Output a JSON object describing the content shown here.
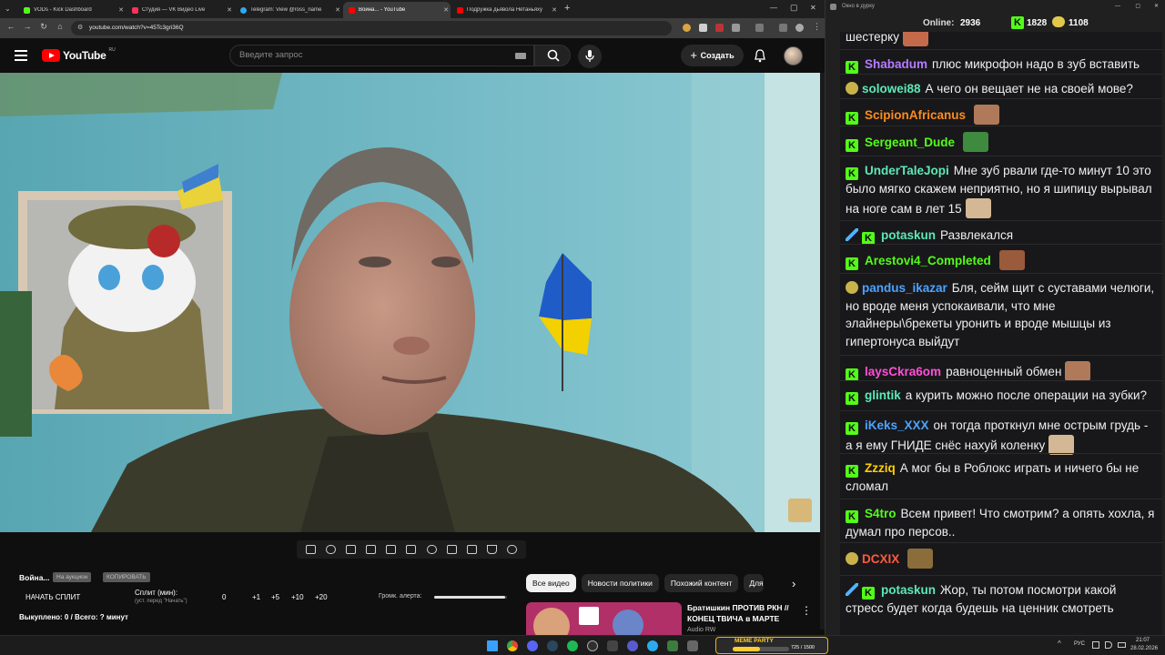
{
  "browser": {
    "tabs": [
      {
        "label": "VODs - Kick Dashboard",
        "color": "#53fc18"
      },
      {
        "label": "Студия — VK Видео Live",
        "color": "#ff3355"
      },
      {
        "label": "Telegram: View @ross_name",
        "color": "#2aabee"
      },
      {
        "label": "Война... - YouTube",
        "color": "#ff0000"
      },
      {
        "label": "Подружка дьявола Нетаньяху",
        "color": "#ff0000"
      }
    ],
    "new_tab": "+",
    "url": "youtube.com/watch?v=45Tc3gri36Q",
    "window_controls": [
      "—",
      "▢",
      "✕"
    ]
  },
  "youtube": {
    "logo_text": "YouTube",
    "logo_cc": "RU",
    "search_placeholder": "Введите запрос",
    "create_label": "Создать",
    "icons": [
      "menu-icon",
      "search-icon",
      "mic-icon",
      "bell-icon",
      "avatar"
    ]
  },
  "video_controls": {
    "icons": [
      "repeat-icon",
      "broadcast-icon",
      "camera-settings-icon",
      "clip-icon",
      "screen-icon",
      "subtitles-icon",
      "speed-icon",
      "add-icon",
      "screenshot-icon",
      "flask-icon",
      "gear-icon"
    ]
  },
  "tool": {
    "title": "Война...",
    "btn_auction": "На аукцион",
    "btn_copy": "КОПИРОВАТЬ",
    "start_split": "НАЧАТЬ СПЛИТ",
    "split_label": "Сплит (мин):",
    "split_hint": "(уст. перед \"Начать\")",
    "split_value": "0",
    "increments": [
      "+1",
      "+5",
      "+10",
      "+20"
    ],
    "alert_label": "Громк. алерта:",
    "bought": "Выкуплено: 0 / Всего: ? минут",
    "alert_volume": 0.98
  },
  "chips": [
    "Все видео",
    "Новости политики",
    "Похожий контент",
    "Для вас"
  ],
  "recommendation": {
    "title_line1": "Братишкин ПРОТИВ РКН //",
    "title_line2": "КОНЕЦ ТВИЧА в МАРТЕ",
    "channel": "Audio RW"
  },
  "chat": {
    "window_title": "Окно в дурку",
    "online_label": "Online:",
    "online_count": "2936",
    "kick_count": "1828",
    "other_count": "1108",
    "messages": [
      {
        "user": "",
        "text": "шестерку",
        "color": "#ffffff",
        "emote": true
      },
      {
        "user": "Shabadum",
        "text": "плюс микрофон надо в зуб вставить",
        "color": "#b57cff",
        "badge": "kick"
      },
      {
        "user": "solowei88",
        "text": "А чего он вещает не на своей мове?",
        "color": "#5ee8b5",
        "badge": "sub"
      },
      {
        "user": "ScipionAfricanus",
        "text": "",
        "color": "#ff8c1a",
        "badge": "kick",
        "emote": true
      },
      {
        "user": "Sergeant_Dude",
        "text": "",
        "color": "#53fc18",
        "badge": "kick",
        "emote": true
      },
      {
        "user": "UnderTaleJopi",
        "text": "Мне зуб рвали где-то минут 10 это было мягко скажем неприятно, но я шипицу вырывал на ноге сам в лет 15",
        "color": "#5ee8b5",
        "badge": "kick",
        "emote": true
      },
      {
        "user": "potaskun",
        "text": "Развлекался",
        "color": "#5ee8b5",
        "badge": "mod"
      },
      {
        "user": "Arestovi4_Completed",
        "text": "",
        "color": "#53fc18",
        "badge": "kick",
        "emote": true
      },
      {
        "user": "pandus_ikazar",
        "text": "Бля, сейм щит с суставами челюги, но вроде меня успокаивали, что мне элайнеры\\брекеты уронить и вроде мышцы из гипертонуса выйдут",
        "color": "#4da3ff",
        "badge": "sub"
      },
      {
        "user": "laysCkra6om",
        "text": "равноценный обмен",
        "color": "#ff4fd8",
        "badge": "kick",
        "emote": true
      },
      {
        "user": "glintik",
        "text": "а курить можно после операции на зубки?",
        "color": "#5ee8b5",
        "badge": "kick"
      },
      {
        "user": "iKeks_XXX",
        "text": "он тогда проткнул мне острым грудь - а я ему ГНИДЕ снёс нахуй коленку",
        "color": "#4da3ff",
        "badge": "kick",
        "emote": true
      },
      {
        "user": "Zzziq",
        "text": "А мог бы в Роблокс играть и ничего бы не сломал",
        "color": "#ffd000",
        "badge": "kick"
      },
      {
        "user": "S4tro",
        "text": "Всем привет! Что смотрим? а опять хохла, я думал про персов..",
        "color": "#53fc18",
        "badge": "kick"
      },
      {
        "user": "DCXIX",
        "text": "",
        "color": "#ff5a3c",
        "badge": "sub",
        "emote": true
      },
      {
        "user": "potaskun",
        "text": "Жор, ты потом посмотри какой стресс будет когда будешь на ценник смотреть",
        "color": "#5ee8b5",
        "badge": "mod"
      }
    ]
  },
  "taskbar": {
    "meme_label": "MEME PARTY",
    "meme_counter": "725 / 1500",
    "lang": "РУС",
    "time": "21:07",
    "date": "28.02.2026"
  },
  "colors": {
    "kick_green": "#53fc18",
    "yt_red": "#ff0000"
  }
}
